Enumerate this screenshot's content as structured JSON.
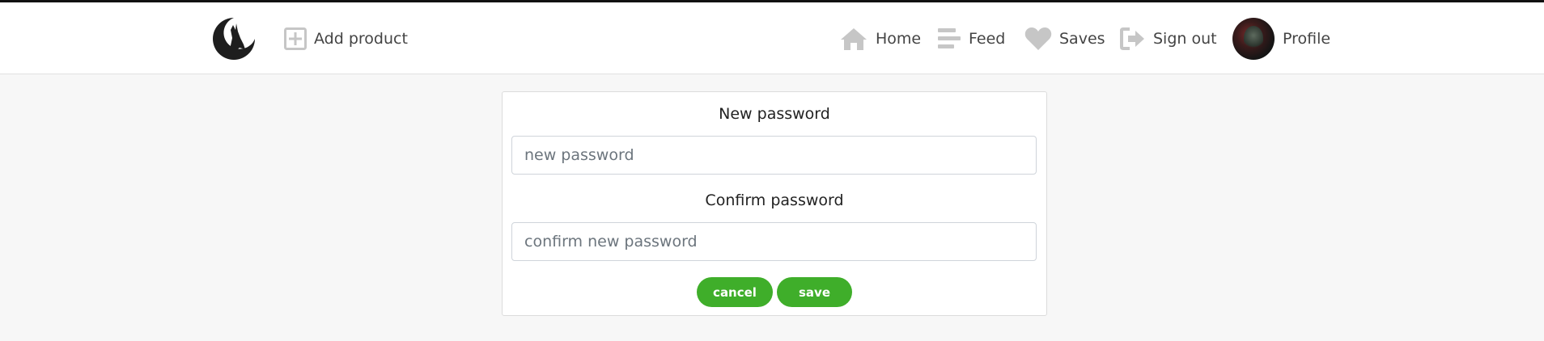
{
  "header": {
    "add_product": "Add product",
    "home": "Home",
    "feed": "Feed",
    "saves": "Saves",
    "sign_out": "Sign out",
    "profile": "Profile",
    "icons": [
      "wolf-moon-logo",
      "plus-square-icon",
      "home-icon",
      "feed-icon",
      "heart-icon",
      "sign-out-icon",
      "avatar"
    ]
  },
  "form": {
    "new_password_label": "New password",
    "new_password_placeholder": "new password",
    "new_password_value": "",
    "confirm_password_label": "Confirm password",
    "confirm_password_placeholder": "confirm new password",
    "confirm_password_value": "",
    "cancel_label": "cancel",
    "save_label": "save"
  },
  "colors": {
    "button": "#3fae2a",
    "icon": "#c6c6c6",
    "background": "#f7f7f7"
  }
}
